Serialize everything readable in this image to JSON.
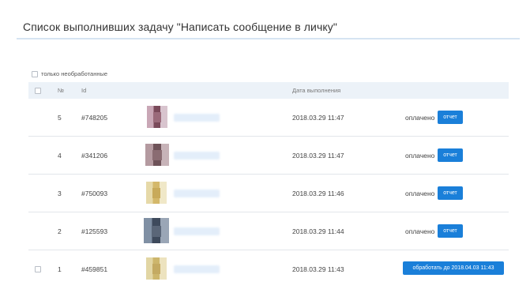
{
  "page": {
    "title": "Список выполнивших задачу \"Написать сообщение в личку\""
  },
  "filter": {
    "only_unprocessed_label": "только необработанные"
  },
  "table": {
    "headers": {
      "num": "№",
      "id": "Id",
      "date": "Дата выполнения"
    },
    "rows": [
      {
        "num": "5",
        "id": "#748205",
        "date": "2018.03.29 11:47",
        "status": "оплачено",
        "action": "отчет",
        "avatar": [
          "#c9a7b6",
          "#7a4a5a",
          "#d8c4ce",
          "#9a6a7a"
        ]
      },
      {
        "num": "4",
        "id": "#341206",
        "date": "2018.03.29 11:47",
        "status": "оплачено",
        "action": "отчет",
        "avatar": [
          "#b49aa0",
          "#6e5258",
          "#c7b3b8",
          "#8a6c72"
        ]
      },
      {
        "num": "3",
        "id": "#750093",
        "date": "2018.03.29 11:46",
        "status": "оплачено",
        "action": "отчет",
        "avatar": [
          "#e6d9a8",
          "#d4b86a",
          "#f0e8c8",
          "#c8aa5a"
        ]
      },
      {
        "num": "2",
        "id": "#125593",
        "date": "2018.03.29 11:44",
        "status": "оплачено",
        "action": "отчет",
        "avatar": [
          "#8090a4",
          "#3e4a5c",
          "#9aa6b6",
          "#5a6678"
        ]
      },
      {
        "num": "1",
        "id": "#459851",
        "date": "2018.03.29 11:43",
        "status": "",
        "action": "обработать до 2018.04.03 11:43",
        "avatar": [
          "#e2d6a4",
          "#cdb66c",
          "#ede3bf",
          "#c4aa62"
        ]
      }
    ]
  },
  "colors": {
    "accent": "#1a7fd9",
    "header_bg": "#ecf2f8",
    "title_line": "#d6e4f2"
  }
}
